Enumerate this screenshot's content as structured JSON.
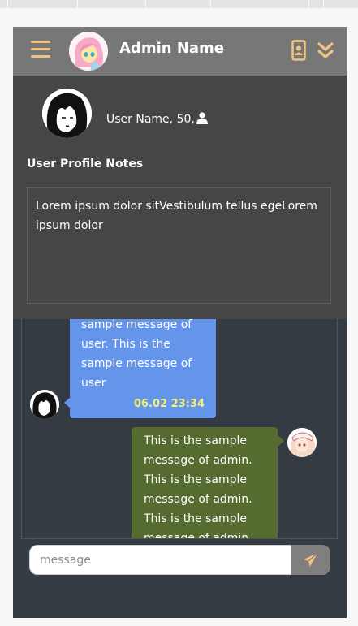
{
  "header": {
    "admin_name": "Admin Name",
    "menu_icon": "menu-icon",
    "contact_icon": "contact-card-icon",
    "toggle_icon": "double-chevron-down-icon",
    "accent_color": "#f0c47e"
  },
  "profile": {
    "user_info": "User Name, 50,",
    "user_icon": "user-icon",
    "notes_label": "User Profile Notes",
    "notes_text": "Lorem ipsum dolor sitVestibulum tellus egeLorem ipsum dolor"
  },
  "chat": {
    "messages": [
      {
        "sender": "user",
        "lines": [
          "sample message of",
          "user. This is the",
          "sample message of",
          "user"
        ],
        "time": "06.02 23:34",
        "color": "#6595eb"
      },
      {
        "sender": "admin",
        "lines": [
          "This is the sample",
          "message of admin.",
          "This is the sample",
          "message of admin.",
          "This is the sample",
          "message of admin."
        ],
        "color": "#556b2f"
      }
    ]
  },
  "composer": {
    "placeholder": "message",
    "send_icon": "send-icon"
  }
}
